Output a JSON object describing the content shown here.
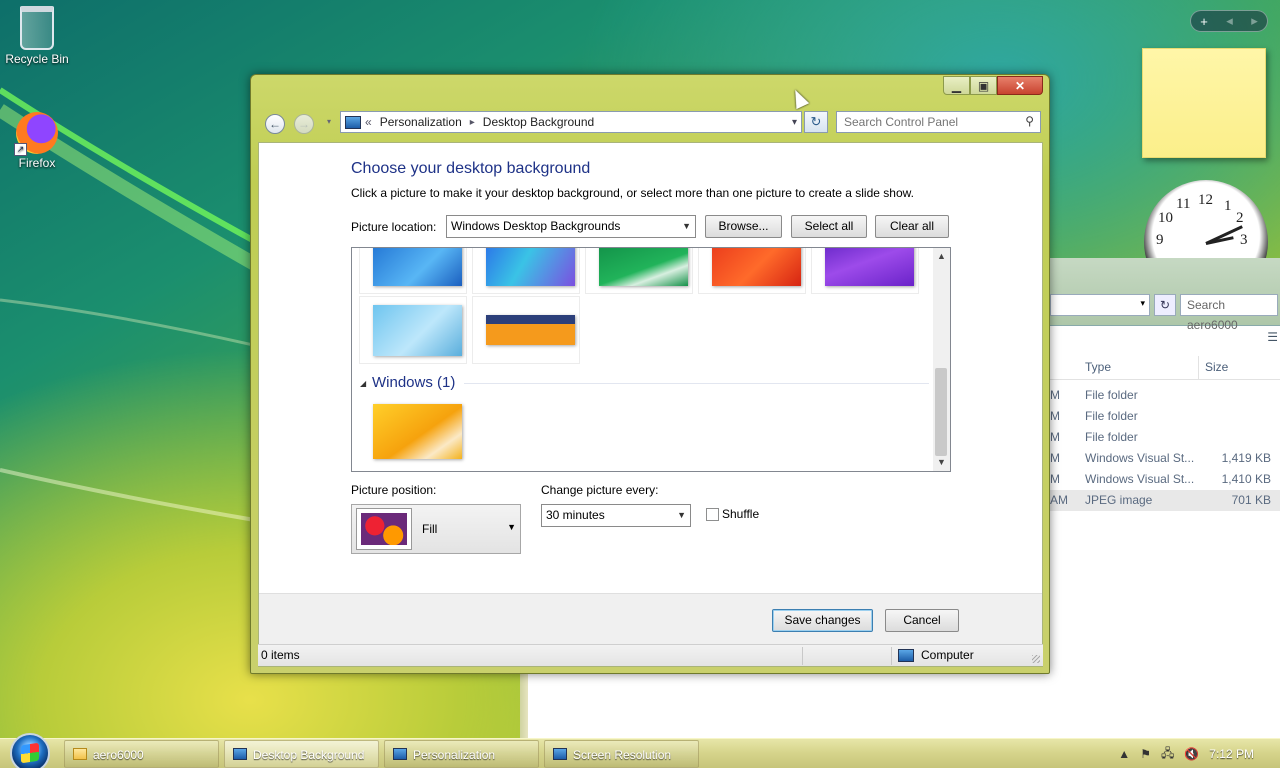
{
  "desktop": {
    "icons": [
      {
        "label": "Recycle Bin"
      },
      {
        "label": "Firefox"
      }
    ]
  },
  "sidebar": {
    "add_label": "+",
    "prev_label": "◂",
    "next_label": "▸"
  },
  "clock": {
    "numbers": [
      "12",
      "1",
      "2",
      "3",
      "10",
      "11",
      "9"
    ]
  },
  "background_window": {
    "search_placeholder": "Search aero6000",
    "columns": {
      "type": "Type",
      "size": "Size"
    },
    "rows": [
      {
        "m": "M",
        "type": "File folder",
        "size": ""
      },
      {
        "m": "M",
        "type": "File folder",
        "size": ""
      },
      {
        "m": "M",
        "type": "File folder",
        "size": ""
      },
      {
        "m": "M",
        "type": "Windows Visual St...",
        "size": "1,419 KB"
      },
      {
        "m": "M",
        "type": "Windows Visual St...",
        "size": "1,410 KB"
      },
      {
        "m": "AM",
        "type": "JPEG image",
        "size": "701 KB"
      }
    ]
  },
  "window": {
    "address": {
      "chevrons": "«",
      "crumb1": "Personalization",
      "crumb2": "Desktop Background"
    },
    "search_placeholder": "Search Control Panel",
    "heading": "Choose your desktop background",
    "subtext": "Click a picture to make it your desktop background, or select more than one picture to create a slide show.",
    "picture_location_label": "Picture location:",
    "picture_location_value": "Windows Desktop Backgrounds",
    "browse_label": "Browse...",
    "select_all_label": "Select all",
    "clear_all_label": "Clear all",
    "group_title": "Windows (1)",
    "picture_position_label": "Picture position:",
    "picture_position_value": "Fill",
    "change_every_label": "Change picture every:",
    "change_every_value": "30 minutes",
    "shuffle_label": "Shuffle",
    "shuffle_checked": false,
    "save_label": "Save changes",
    "cancel_label": "Cancel",
    "status_items": "0 items",
    "status_location": "Computer"
  },
  "taskbar": {
    "items": [
      {
        "label": "aero6000"
      },
      {
        "label": "Desktop Background"
      },
      {
        "label": "Personalization"
      },
      {
        "label": "Screen Resolution"
      }
    ],
    "time": "7:12 PM"
  },
  "colors": {
    "heading": "#1e3287",
    "window_frame": "#c4d15c"
  }
}
